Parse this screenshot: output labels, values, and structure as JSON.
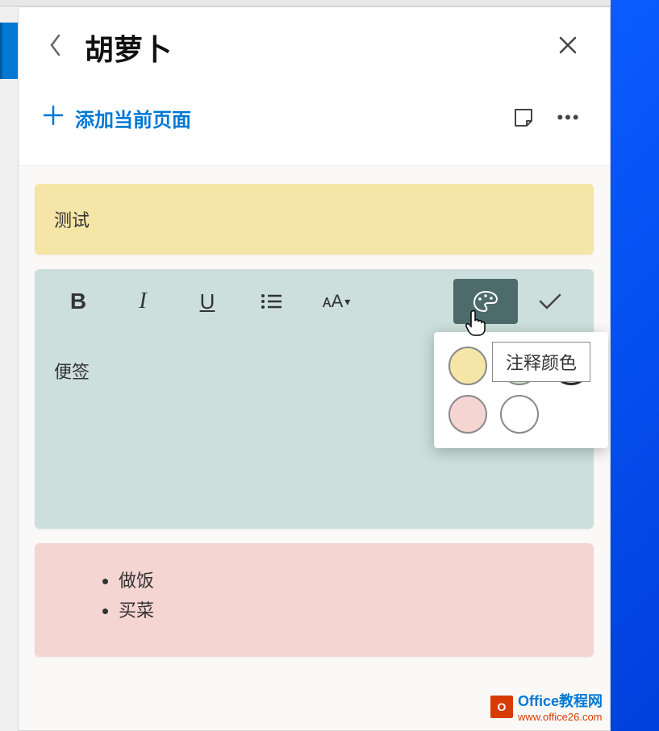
{
  "header": {
    "back_icon": "chevron-left",
    "title": "胡萝卜",
    "close_icon": "close"
  },
  "actions": {
    "add_label": "添加当前页面",
    "sticker_icon": "sticker",
    "more_icon": "more"
  },
  "notes": {
    "yellow_note": {
      "text": "测试",
      "color": "#f5e6a8"
    },
    "teal_note": {
      "text": "便签",
      "color": "#ccdfdc",
      "toolbar": {
        "bold": "B",
        "italic": "I",
        "underline": "U",
        "list": "list",
        "font": "ᴀA",
        "font_caret": "▾",
        "palette": "palette",
        "confirm": "✓"
      },
      "color_tooltip": "注释颜色",
      "color_options": [
        {
          "name": "yellow",
          "hex": "#f5e6a8"
        },
        {
          "name": "green",
          "hex": "#cde2c8"
        },
        {
          "name": "teal",
          "hex": "#cce6eb",
          "selected": true
        },
        {
          "name": "pink",
          "hex": "#f4d5d2"
        },
        {
          "name": "white",
          "hex": "#ffffff"
        }
      ]
    },
    "pink_note": {
      "color": "#f4d5d2",
      "items": [
        "做饭",
        "买菜"
      ]
    }
  },
  "watermark": {
    "logo_text": "O",
    "brand": "Office教程网",
    "url": "www.office26.com"
  }
}
